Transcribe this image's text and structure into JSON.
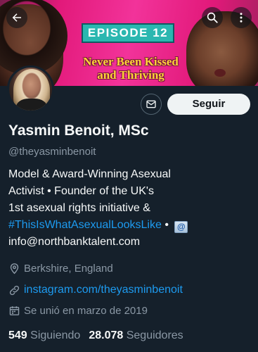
{
  "banner": {
    "episode_label": "EPISODE 12",
    "tagline_line1": "Never Been Kissed",
    "tagline_line2": "and Thriving"
  },
  "profile": {
    "display_name": "Yasmin Benoit, MSc",
    "handle": "@theyasminbenoit",
    "follow_label": "Seguir",
    "bio": {
      "line1": "Model & Award-Winning Asexual",
      "line2": "Activist • Founder of the UK's",
      "line3": "1st asexual rights initiative &",
      "hashtag": "#ThisIsWhatAsexualLooksLike",
      "separator": " • ",
      "email": "info@northbanktalent.com"
    },
    "location": "Berkshire, England",
    "website": "instagram.com/theyasminbenoit",
    "joined": "Se unió en marzo de 2019",
    "following_count": "549",
    "following_label": "Siguiendo",
    "followers_count": "28.078",
    "followers_label": "Seguidores"
  },
  "colors": {
    "background": "#15202b",
    "link": "#1d9bf0",
    "secondary_text": "#8b98a5",
    "follow_button": "#eff3f4"
  },
  "icons": [
    "back-arrow-icon",
    "search-icon",
    "more-vertical-icon",
    "message-envelope-icon",
    "location-pin-icon",
    "link-icon",
    "calendar-icon",
    "envelope-emoji-icon"
  ]
}
